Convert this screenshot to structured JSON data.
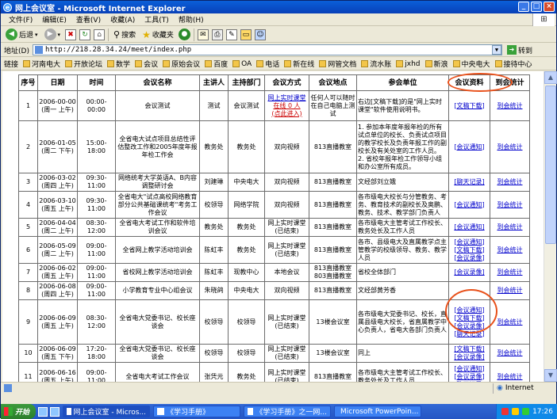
{
  "window": {
    "title": "网上会议室 - Microsoft Internet Explorer"
  },
  "menu": [
    "文件(F)",
    "编辑(E)",
    "查看(V)",
    "收藏(A)",
    "工具(T)",
    "帮助(H)"
  ],
  "toolbar": {
    "back": "后退",
    "search": "搜索",
    "favorites": "收藏夹"
  },
  "address": {
    "label": "地址(D)",
    "url": "http://218.28.34.24/meet/index.php",
    "go": "转到"
  },
  "links": {
    "label": "链接",
    "items": [
      "河南电大",
      "开放论坛",
      "数学",
      "会议",
      "原始会议",
      "百度",
      "OA",
      "电话",
      "新在线",
      "网管文档",
      "流水账",
      "jxhd",
      "新浪",
      "中央电大",
      "接待中心"
    ]
  },
  "table": {
    "headers": [
      "序号",
      "日期",
      "时间",
      "会议名称",
      "主讲人",
      "主持部门",
      "会议方式",
      "会议地点",
      "参会单位",
      "会议资料",
      "到会统计"
    ],
    "rows": [
      {
        "no": "1",
        "date": "2006-00-00 (周一 上午)",
        "time": "00:00-00:00",
        "name": "会议测试",
        "speaker": "测试",
        "dept": "会议测试",
        "mode": [
          "网上实时课堂"
        ],
        "mode_red": [
          "在线 0 人",
          "(点此进入)"
        ],
        "place": "任何人可以随时在自己电脑上测试",
        "units": "右边[文稿下载]的是\"网上实时课堂\"软件使用说明书。",
        "docs": [
          "[文稿下载]"
        ],
        "stat": "到会统计"
      },
      {
        "no": "2",
        "date": "2006-01-05 (周二 下午)",
        "time": "15:00-18:00",
        "name": "全省电大试点项目总结性评估整改工作和2005年度年报年检工作会",
        "speaker": "教务处",
        "dept": "教务处",
        "mode": [
          "双向视频"
        ],
        "mode_red": [],
        "place": "813直播教室",
        "units": "1. 参加本年度年报年检的所有试点单位的校长、负责试点项目的教学校长及负责年报工作的副校长及有关处室的工作人员。 2. 省校年报年检工作领导小组和办公室所有成员。",
        "docs": [
          "[会议通知]"
        ],
        "stat": "到会统计"
      },
      {
        "no": "3",
        "date": "2006-03-02 (周四 上午)",
        "time": "09:30-11:00",
        "name": "网络统考大学英语A、B内容调整研讨会",
        "speaker": "刘建琳",
        "dept": "中央电大",
        "mode": [
          "双向视频"
        ],
        "mode_red": [],
        "place": "813直播教室",
        "units": "文经部刘立娥",
        "docs": [
          "[聊天记录]"
        ],
        "stat": "到会统计"
      },
      {
        "no": "4",
        "date": "2006-03-10 (周五 上午)",
        "time": "09:30-11:00",
        "name": "全省电大\"试点高校网络教育部分公共基础课统考\"考务工作会议",
        "speaker": "校领导",
        "dept": "网络学院",
        "mode": [
          "双向视频"
        ],
        "mode_red": [],
        "place": "813直播教室",
        "units": "各市级电大校长与分管教务、考务、教育技术的副校长及奥鹏、教务、技术、教学部门负责人",
        "docs": [
          "[会议通知]"
        ],
        "stat": "到会统计"
      },
      {
        "no": "5",
        "date": "2006-04-04 (周二 上午)",
        "time": "08:30-12:00",
        "name": "全省电大考试工作和软件培训会议",
        "speaker": "教务处",
        "dept": "教务处",
        "mode": [
          "网上实时课堂",
          "(已结束)"
        ],
        "mode_red": [],
        "place": "813直播教室",
        "units": "各市级电大主管考试工作校长、教务处长及工作人员",
        "docs": [
          "[会议通知]"
        ],
        "stat": "到会统计"
      },
      {
        "no": "6",
        "date": "2006-05-09 (周二 上午)",
        "time": "09:00-11:00",
        "name": "全省网上教学活动培训会",
        "speaker": "陈虹丰",
        "dept": "教务处",
        "mode": [
          "网上实时课堂",
          "(已结束)"
        ],
        "mode_red": [],
        "place": "813直播教室",
        "units": "各市、县级电大及直属教学点主管教学的校级领导、教务、教学人员",
        "docs": [
          "[会议通知]",
          "[文稿下载]",
          "[会议录像]"
        ],
        "stat": "到会统计"
      },
      {
        "no": "7",
        "date": "2006-06-02 (周五 上午)",
        "time": "09:00-11:00",
        "name": "省校网上教学活动培训会",
        "speaker": "陈虹丰",
        "dept": "现教中心",
        "mode": [
          "本地会议"
        ],
        "mode_red": [],
        "place": "813直播教室 803直播教室",
        "units": "省校全体部门",
        "docs": [
          "[会议录像]"
        ],
        "stat": "到会统计"
      },
      {
        "no": "8",
        "date": "2006-06-08 (周四 上午)",
        "time": "09:00-11:00",
        "name": "小学教育专业中心组会议",
        "speaker": "朱晓鸽",
        "dept": "中央电大",
        "mode": [
          "双向视频"
        ],
        "mode_red": [],
        "place": "813直播教室",
        "units": "文经部黄芳香",
        "docs": [],
        "stat": "到会统计"
      },
      {
        "no": "9",
        "date": "2006-06-09 (周五 上午)",
        "time": "08:30-12:00",
        "name": "全省电大党委书记、校长座谈会",
        "speaker": "校领导",
        "dept": "校领导",
        "mode": [
          "网上实时课堂",
          "(已结束)"
        ],
        "mode_red": [],
        "place": "13楼会议室",
        "units": "各市级电大党委书记、校长，直属县级电大校长，省直属教学中心负责人，省电大各部门负责人",
        "docs": [
          "[会议通知]",
          "[文稿下载]",
          "[会议录像]",
          "[聊天记录]"
        ],
        "stat": "到会统计"
      },
      {
        "no": "10",
        "date": "2006-06-09 (周五 下午)",
        "time": "17:20-18:00",
        "name": "全省电大党委书记、校长座谈会",
        "speaker": "校领导",
        "dept": "校领导",
        "mode": [
          "网上实时课堂",
          "(已结束)"
        ],
        "mode_red": [],
        "place": "13楼会议室",
        "units": "同上",
        "docs": [
          "[文稿下载]",
          "[会议录像]"
        ],
        "stat": "到会统计"
      },
      {
        "no": "11",
        "date": "2006-06-16 (周五 上午)",
        "time": "09:00-11:00",
        "name": "全省电大考试工作会议",
        "speaker": "张凭元",
        "dept": "教务处",
        "mode": [
          "网上实时课堂",
          "(已结束)"
        ],
        "mode_red": [],
        "place": "813直播教室",
        "units": "各市级电大主管考试工作校长、教务处长及工作人员",
        "docs": [
          "[会议通知]",
          "[会议录像]",
          "[聊天记录]"
        ],
        "stat": "到会统计"
      }
    ]
  },
  "status": {
    "zone": "Internet"
  },
  "taskbar": {
    "start": "开始",
    "tasks": [
      "网上会议室 - Micros...",
      "《学习手册》",
      "《学习手册》之一网...",
      "Microsoft PowerPoin..."
    ],
    "clock": "17:26"
  },
  "colors": {
    "link": "#0000cc",
    "red": "#cc0000",
    "highlight": "#e8501a"
  }
}
